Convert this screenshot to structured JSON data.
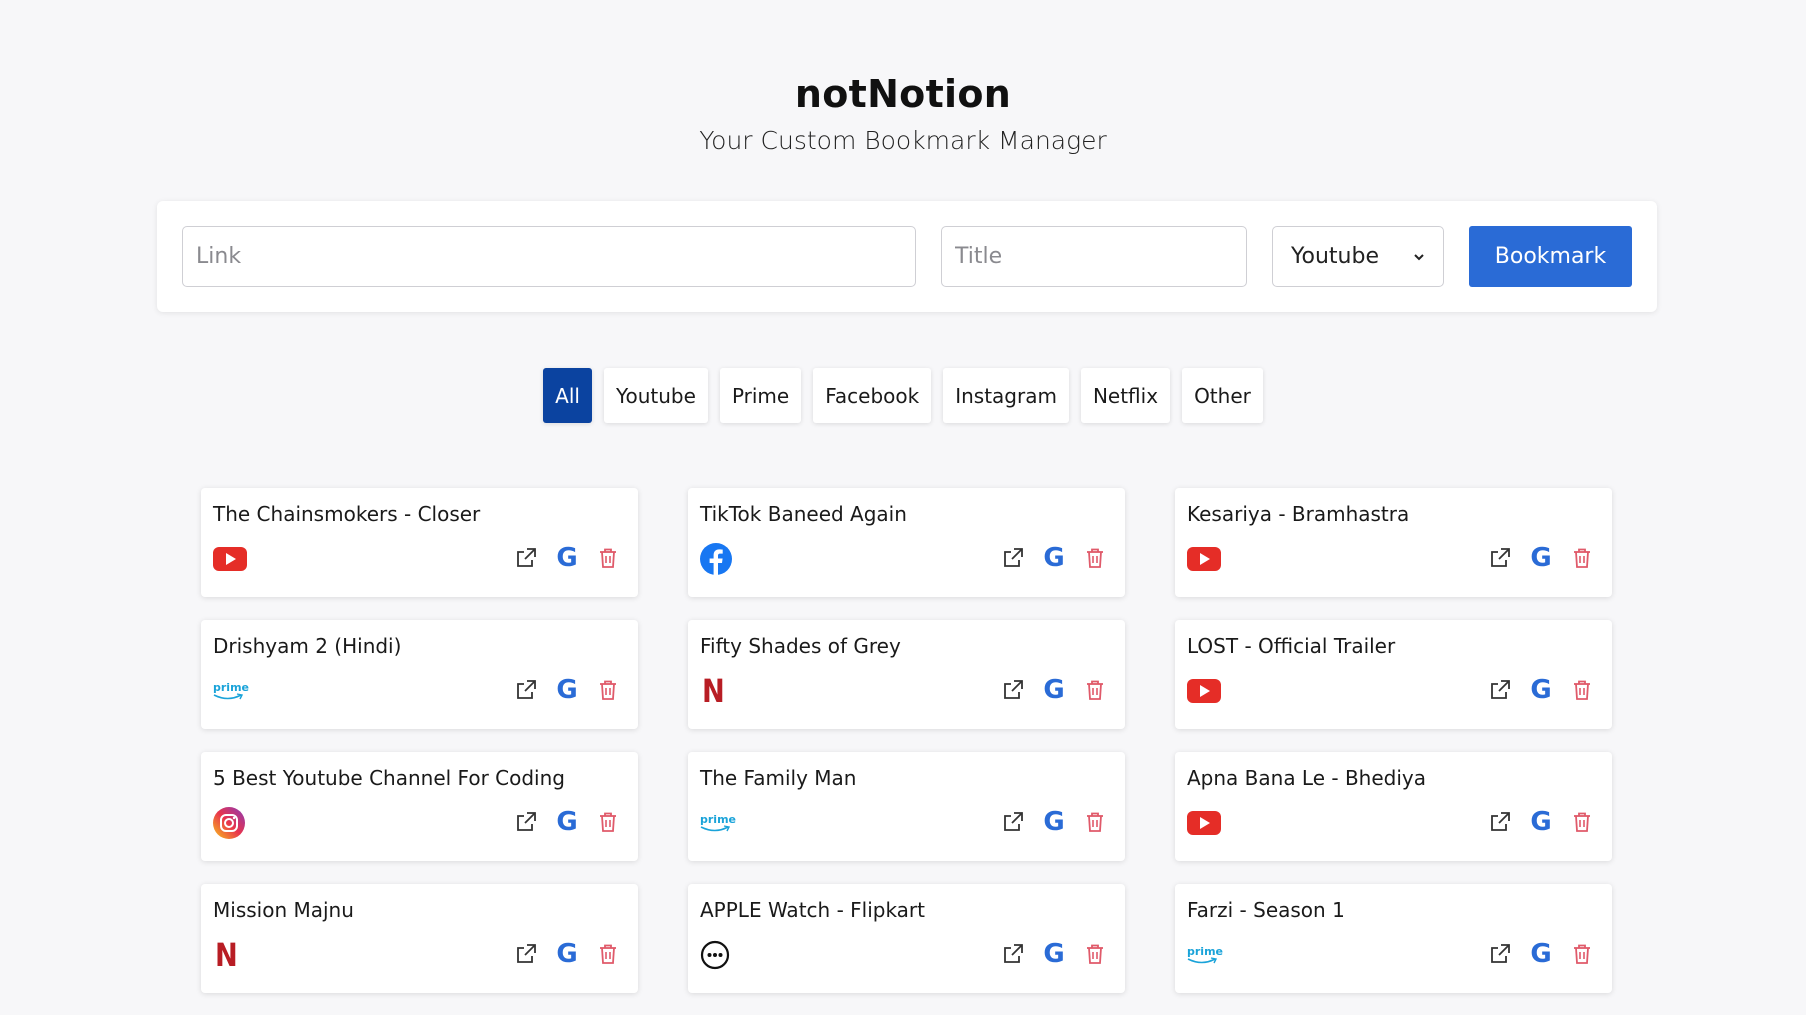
{
  "app": {
    "title": "notNotion",
    "subtitle": "Your Custom Bookmark Manager"
  },
  "form": {
    "link_placeholder": "Link",
    "title_placeholder": "Title",
    "type_selected": "Youtube",
    "submit_label": "Bookmark"
  },
  "filters": [
    "All",
    "Youtube",
    "Prime",
    "Facebook",
    "Instagram",
    "Netflix",
    "Other"
  ],
  "active_filter": "All",
  "colors": {
    "accent": "#2a6bd6",
    "active_filter": "#0b43a0",
    "delete": "#e05a6a"
  },
  "bookmarks": [
    {
      "title": "The Chainsmokers - Closer",
      "platform": "youtube-icon"
    },
    {
      "title": "TikTok Baneed Again",
      "platform": "facebook-icon"
    },
    {
      "title": "Kesariya - Bramhastra",
      "platform": "youtube-icon"
    },
    {
      "title": "Drishyam 2 (Hindi)",
      "platform": "prime-icon"
    },
    {
      "title": "Fifty Shades of Grey",
      "platform": "netflix-icon"
    },
    {
      "title": "LOST - Official Trailer",
      "platform": "youtube-icon"
    },
    {
      "title": "5 Best Youtube Channel For Coding",
      "platform": "instagram-icon"
    },
    {
      "title": "The Family Man",
      "platform": "prime-icon"
    },
    {
      "title": "Apna Bana Le - Bhediya",
      "platform": "youtube-icon"
    },
    {
      "title": "Mission Majnu",
      "platform": "netflix-icon"
    },
    {
      "title": "APPLE Watch - Flipkart",
      "platform": "other-icon"
    },
    {
      "title": "Farzi - Season 1",
      "platform": "prime-icon"
    }
  ],
  "icon_labels": {
    "prime_text": "prime",
    "netflix_text": "N",
    "google_text": "G"
  }
}
